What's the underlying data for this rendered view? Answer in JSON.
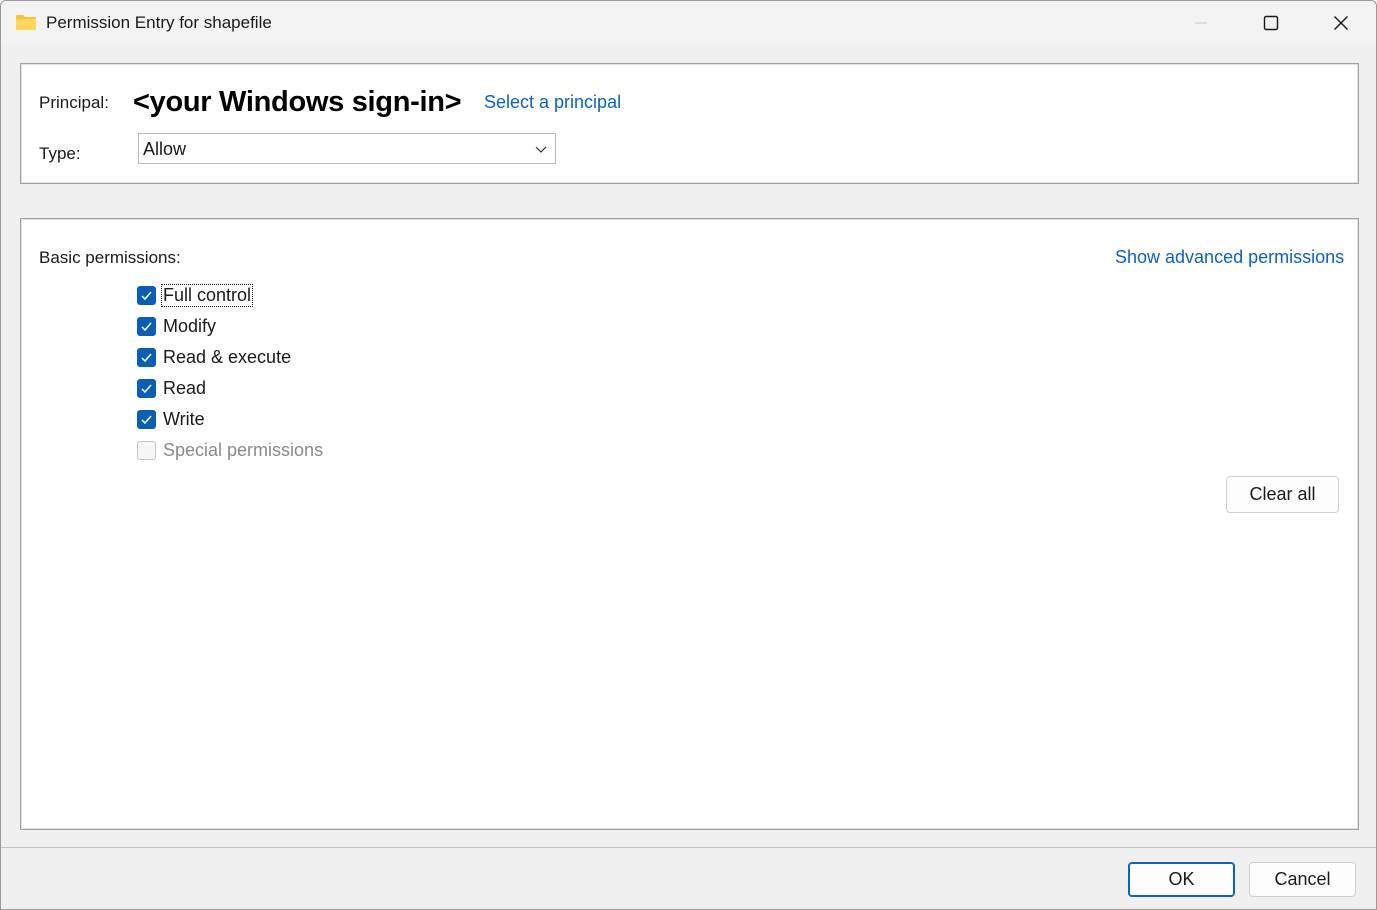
{
  "window": {
    "title": "Permission Entry for shapefile",
    "icon": "folder-icon"
  },
  "principal": {
    "label": "Principal:",
    "name": "<your Windows sign-in>",
    "select_link": "Select a principal"
  },
  "type": {
    "label": "Type:",
    "value": "Allow"
  },
  "permissions": {
    "heading": "Basic permissions:",
    "advanced_link": "Show advanced permissions",
    "items": [
      {
        "label": "Full control",
        "checked": true,
        "enabled": true
      },
      {
        "label": "Modify",
        "checked": true,
        "enabled": true
      },
      {
        "label": "Read & execute",
        "checked": true,
        "enabled": true
      },
      {
        "label": "Read",
        "checked": true,
        "enabled": true
      },
      {
        "label": "Write",
        "checked": true,
        "enabled": true
      },
      {
        "label": "Special permissions",
        "checked": false,
        "enabled": false
      }
    ],
    "clear_all": "Clear all"
  },
  "footer": {
    "ok": "OK",
    "cancel": "Cancel"
  },
  "colors": {
    "accent": "#0a5fb4",
    "link": "#0a63c1"
  }
}
